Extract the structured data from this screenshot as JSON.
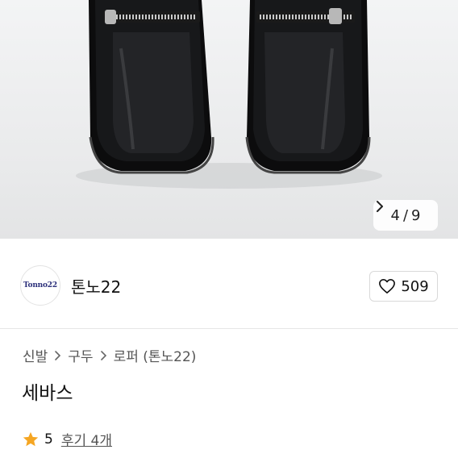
{
  "gallery": {
    "counter_current": "4",
    "counter_sep": "/",
    "counter_total": "9",
    "next_icon": "chevron-right-icon"
  },
  "seller": {
    "avatar_text": "Tonno22",
    "name": "톤노22",
    "like_count": "509",
    "like_icon": "heart-outline-icon"
  },
  "breadcrumb": [
    "신발",
    "구두",
    "로퍼 (톤노22)"
  ],
  "product": {
    "title": "세바스"
  },
  "rating": {
    "score": "5",
    "review_label": "후기 4개",
    "star_color": "#f5a623"
  }
}
